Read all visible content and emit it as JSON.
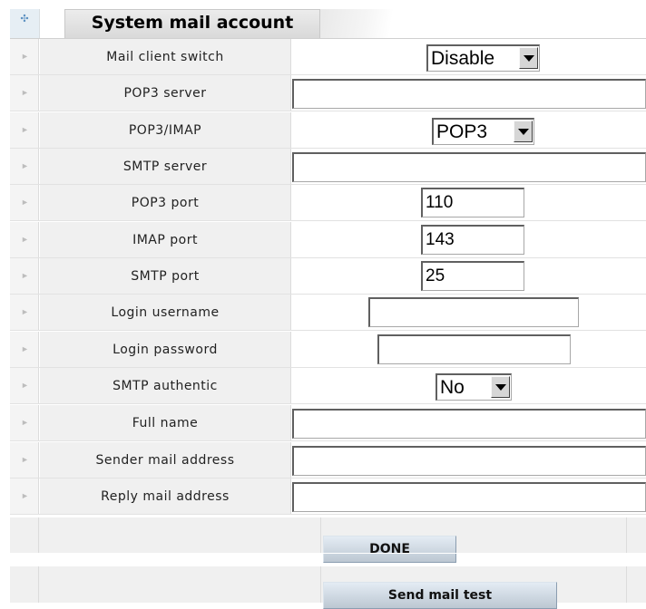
{
  "header": {
    "icon": "expand-icon",
    "title": "System mail account"
  },
  "rows": [
    {
      "label": "Mail client switch",
      "type": "select",
      "value": "Disable"
    },
    {
      "label": "POP3 server",
      "type": "text",
      "value": ""
    },
    {
      "label": "POP3/IMAP",
      "type": "select",
      "value": "POP3"
    },
    {
      "label": "SMTP server",
      "type": "text",
      "value": ""
    },
    {
      "label": "POP3 port",
      "type": "text",
      "value": "110"
    },
    {
      "label": "IMAP port",
      "type": "text",
      "value": "143"
    },
    {
      "label": "SMTP port",
      "type": "text",
      "value": "25"
    },
    {
      "label": "Login username",
      "type": "text",
      "value": ""
    },
    {
      "label": "Login password",
      "type": "password",
      "value": ""
    },
    {
      "label": "SMTP authentic",
      "type": "select",
      "value": "No"
    },
    {
      "label": "Full name",
      "type": "text",
      "value": ""
    },
    {
      "label": "Sender mail address",
      "type": "text",
      "value": ""
    },
    {
      "label": "Reply mail address",
      "type": "text",
      "value": ""
    }
  ],
  "buttons": {
    "done": "DONE",
    "send_test": "Send mail test"
  },
  "icons": {
    "row_marker": "arrow-right-icon",
    "dropdown": "chevron-down-icon"
  }
}
